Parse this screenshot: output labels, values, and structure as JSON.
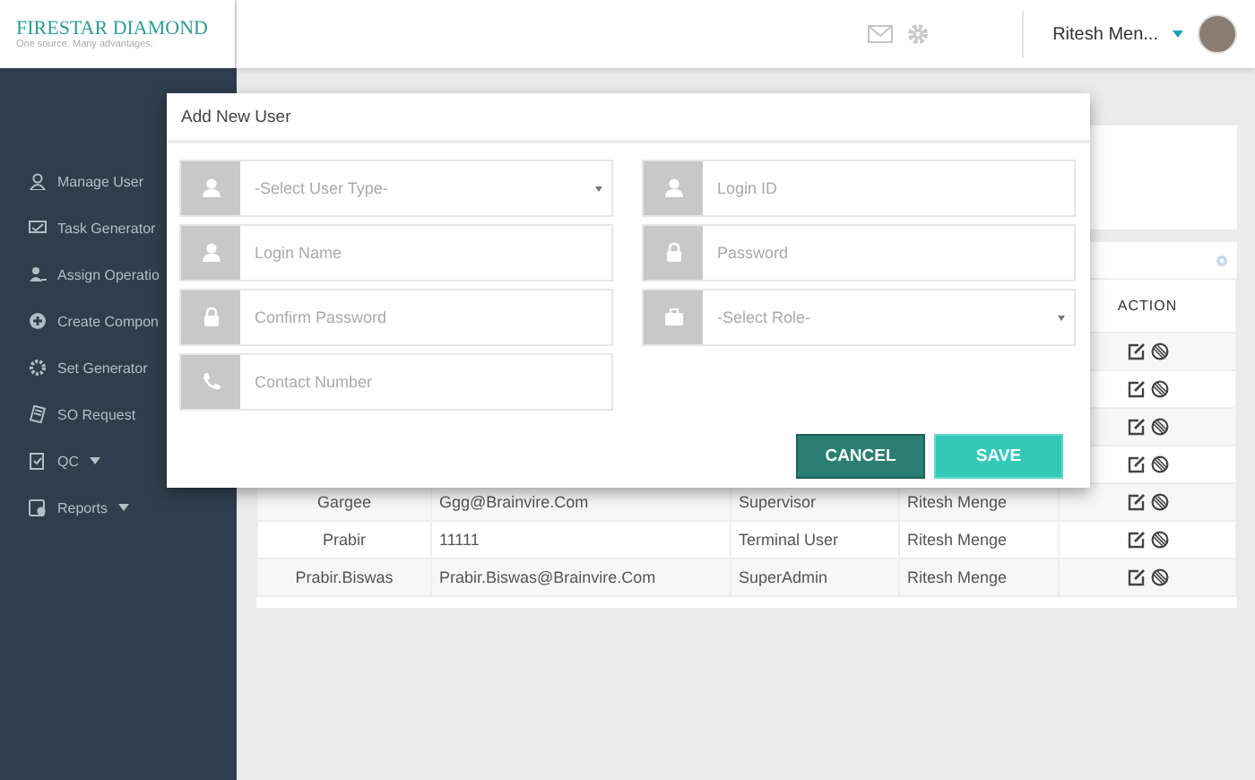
{
  "header": {
    "logo_title": "FIRESTAR DIAMOND",
    "logo_tagline": "One source. Many advantages.",
    "user_name": "Ritesh Men..."
  },
  "sidebar": {
    "items": [
      {
        "label": "Manage User"
      },
      {
        "label": "Task Generator"
      },
      {
        "label": "Assign Operatio"
      },
      {
        "label": "Create Compon"
      },
      {
        "label": "Set Generator"
      },
      {
        "label": "SO Request"
      },
      {
        "label": "QC",
        "dropdown": true
      },
      {
        "label": "Reports",
        "dropdown": true
      }
    ]
  },
  "table": {
    "columns": [
      "ACTION"
    ],
    "rows": [
      {},
      {},
      {},
      {},
      {
        "name": "Gargee",
        "email": "Ggg@Brainvire.Com",
        "role": "Supervisor",
        "created_by": "Ritesh Menge"
      },
      {
        "name": "Prabir",
        "email": "11111",
        "role": "Terminal User",
        "created_by": "Ritesh Menge"
      },
      {
        "name": "Prabir.Biswas",
        "email": "Prabir.Biswas@Brainvire.Com",
        "role": "SuperAdmin",
        "created_by": "Ritesh Menge"
      }
    ]
  },
  "modal": {
    "title": "Add New User",
    "fields": [
      {
        "kind": "person",
        "placeholder": "-Select User Type-",
        "dropdown": true
      },
      {
        "kind": "person",
        "placeholder": "Login ID",
        "dropdown": false
      },
      {
        "kind": "person",
        "placeholder": "Login Name",
        "dropdown": false
      },
      {
        "kind": "lock",
        "placeholder": "Password",
        "dropdown": false
      },
      {
        "kind": "lock",
        "placeholder": "Confirm Password",
        "dropdown": false
      },
      {
        "kind": "briefcase",
        "placeholder": "-Select Role-",
        "dropdown": true
      },
      {
        "kind": "phone",
        "placeholder": "Contact Number",
        "dropdown": false
      }
    ],
    "buttons": [
      {
        "label": "CANCEL",
        "kind": "secondary"
      },
      {
        "label": "SAVE",
        "kind": "primary"
      }
    ]
  }
}
